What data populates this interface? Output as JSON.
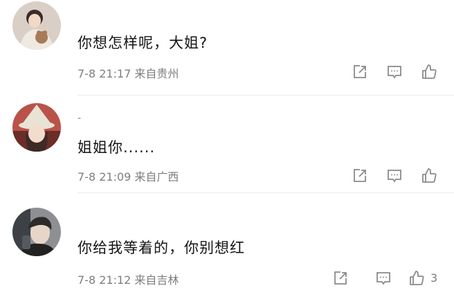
{
  "comments": [
    {
      "username": "",
      "text": "你想怎样呢，大姐?",
      "time": "7-8 21:17",
      "location": "来自贵州",
      "likes": ""
    },
    {
      "username": "-",
      "text": "姐姐你......",
      "time": "7-8 21:09",
      "location": "来自广西",
      "likes": ""
    },
    {
      "username": "",
      "text": "你给我等着的，你别想红",
      "time": "7-8 21:12",
      "location": "来自吉林",
      "likes": "3"
    }
  ],
  "icons": {
    "share": "share-icon",
    "reply": "comment-icon",
    "like": "thumbs-up-icon"
  },
  "colors": {
    "icon": "#8a8a8a",
    "meta_text": "#7d7d7d",
    "content_text": "#141414",
    "divider": "#ececec"
  }
}
